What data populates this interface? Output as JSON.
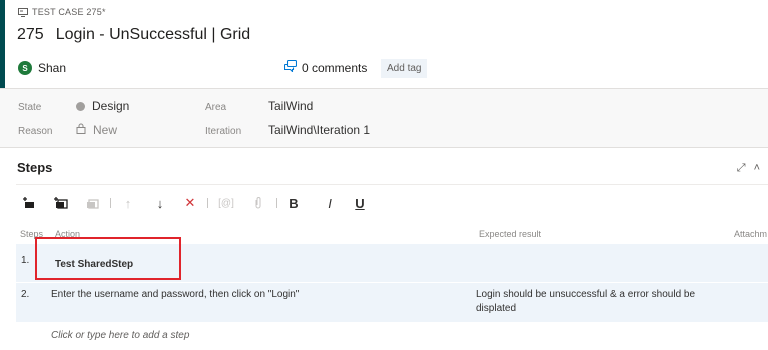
{
  "work_item": {
    "type_label": "TEST CASE 275*",
    "id": "275",
    "title": "Login - UnSuccessful | Grid",
    "assignee": "Shan",
    "assignee_initial": "S",
    "comments_label": "0 comments",
    "add_tag_label": "Add tag"
  },
  "details": {
    "state_label": "State",
    "state_value": "Design",
    "reason_label": "Reason",
    "reason_value": "New",
    "area_label": "Area",
    "area_value": "TailWind",
    "iteration_label": "Iteration",
    "iteration_value": "TailWind\\Iteration 1"
  },
  "steps": {
    "title": "Steps",
    "toolbar": {
      "bold": "B",
      "italic": "I",
      "underline": "U"
    },
    "columns": {
      "steps": "Steps",
      "action": "Action",
      "expected": "Expected result",
      "attachments": "Attachm"
    },
    "rows": [
      {
        "num": "1.",
        "action": "Test SharedStep",
        "expected": ""
      },
      {
        "num": "2.",
        "action": "Enter the username and password, then click on \"Login\"",
        "expected": "Login should be unsuccessful & a error should be displated"
      }
    ],
    "add_step_hint": "Click or type here to add a step"
  },
  "colors": {
    "accent": "#004b50",
    "highlight_border": "#e0242b",
    "row_background": "#eef4fa",
    "delete_icon": "#d13438",
    "avatar": "#1f7a3b"
  }
}
